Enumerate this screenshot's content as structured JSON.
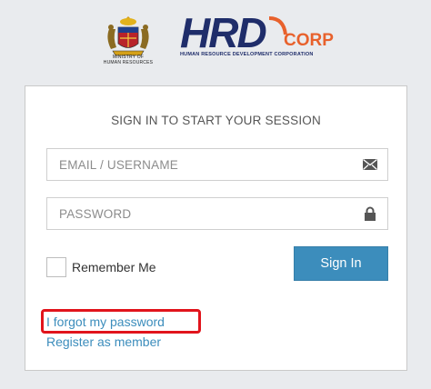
{
  "branding": {
    "ministry_caption_line1": "MINISTRY OF",
    "ministry_caption_line2": "HUMAN RESOURCES",
    "hrd_letters": "HRD",
    "corp_text": "CORP",
    "hrd_tagline": "HUMAN RESOURCE DEVELOPMENT CORPORATION",
    "colors": {
      "navy": "#1f2d6a",
      "orange": "#e8612c"
    }
  },
  "login": {
    "title": "SIGN IN TO START YOUR SESSION",
    "email": {
      "placeholder": "EMAIL / USERNAME",
      "value": "",
      "icon": "envelope-icon"
    },
    "password": {
      "placeholder": "PASSWORD",
      "value": "",
      "icon": "lock-icon"
    },
    "remember_label": "Remember Me",
    "remember_checked": false,
    "signin_label": "Sign In",
    "forgot_link": "I forgot my password",
    "register_link": "Register as member",
    "colors": {
      "primary": "#3c8dbc",
      "highlight": "#e1141c"
    }
  }
}
